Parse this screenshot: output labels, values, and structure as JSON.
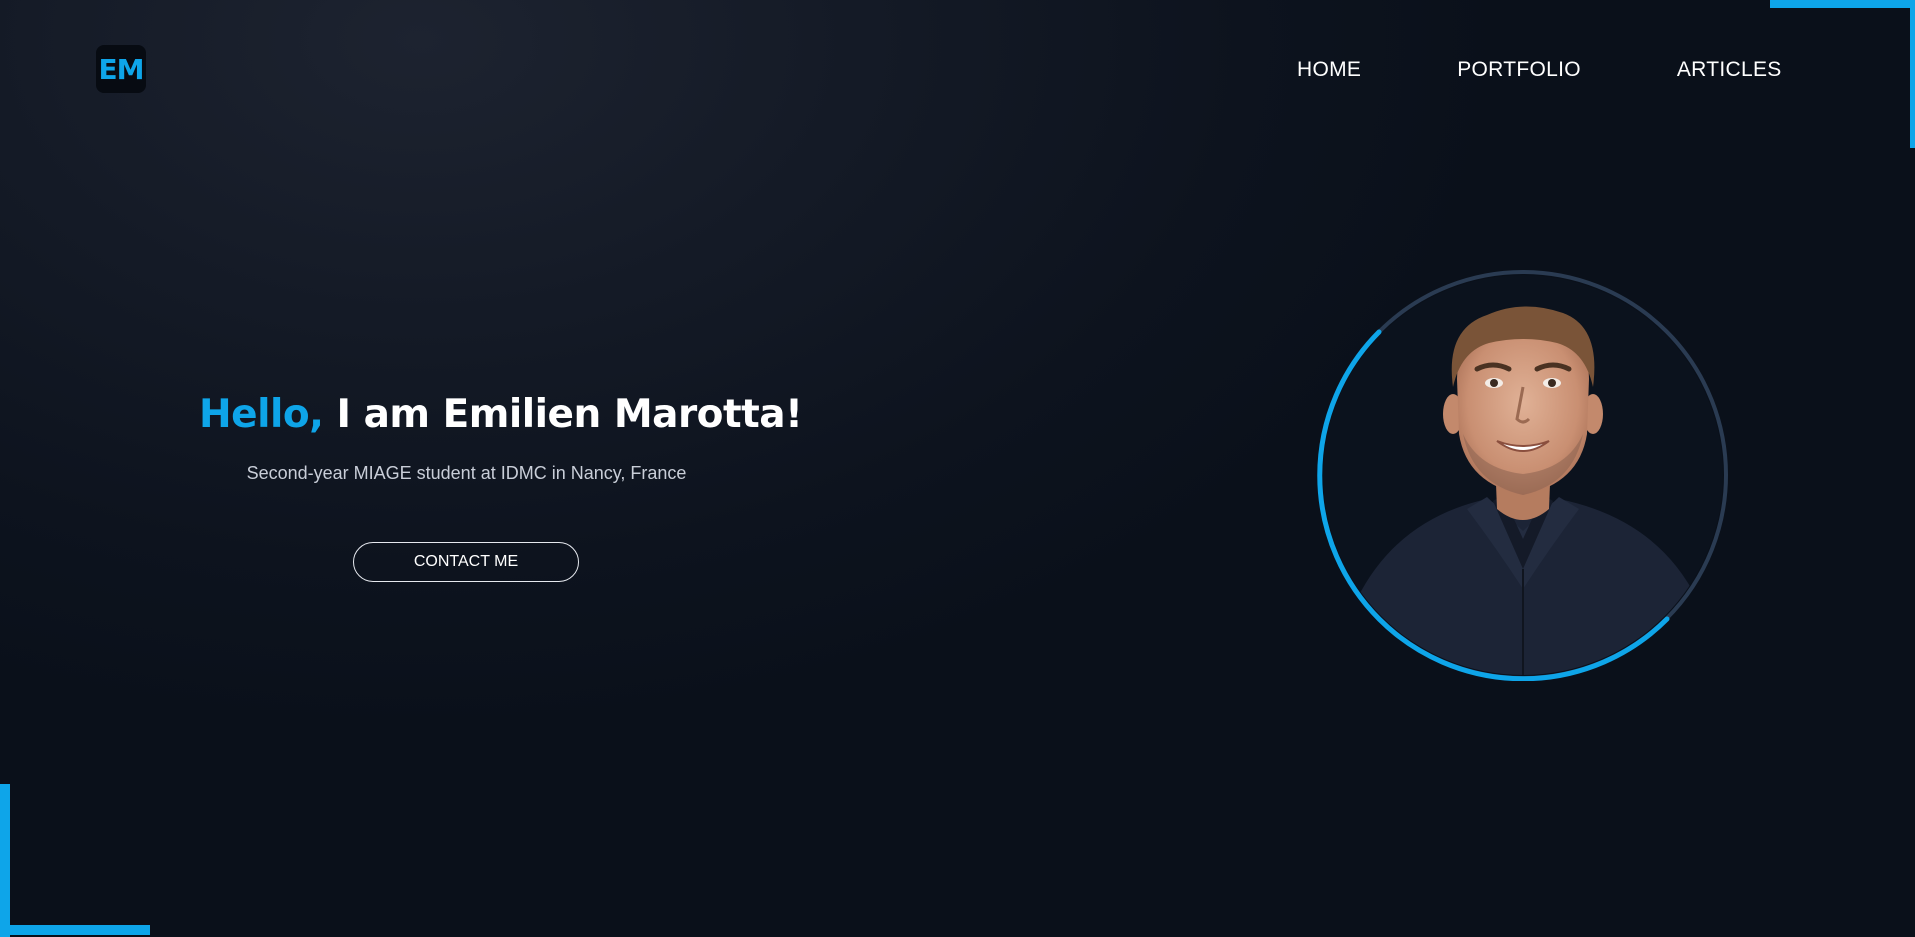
{
  "logo": {
    "text": "EM"
  },
  "nav": {
    "items": [
      {
        "label": "HOME"
      },
      {
        "label": "PORTFOLIO"
      },
      {
        "label": "ARTICLES"
      }
    ]
  },
  "hero": {
    "greeting": "Hello,",
    "name_line": "I am Emilien Marotta!",
    "subtitle": "Second-year MIAGE student at IDMC in Nancy, France",
    "cta_label": "CONTACT ME"
  },
  "colors": {
    "accent": "#0ea5e9",
    "background": "#0b111c",
    "ring_muted": "#2a3b52",
    "text": "#ffffff",
    "subtitle_text": "#c9ced8"
  },
  "icons": {
    "logo": "em-monogram-logo",
    "portrait": "profile-photo"
  }
}
